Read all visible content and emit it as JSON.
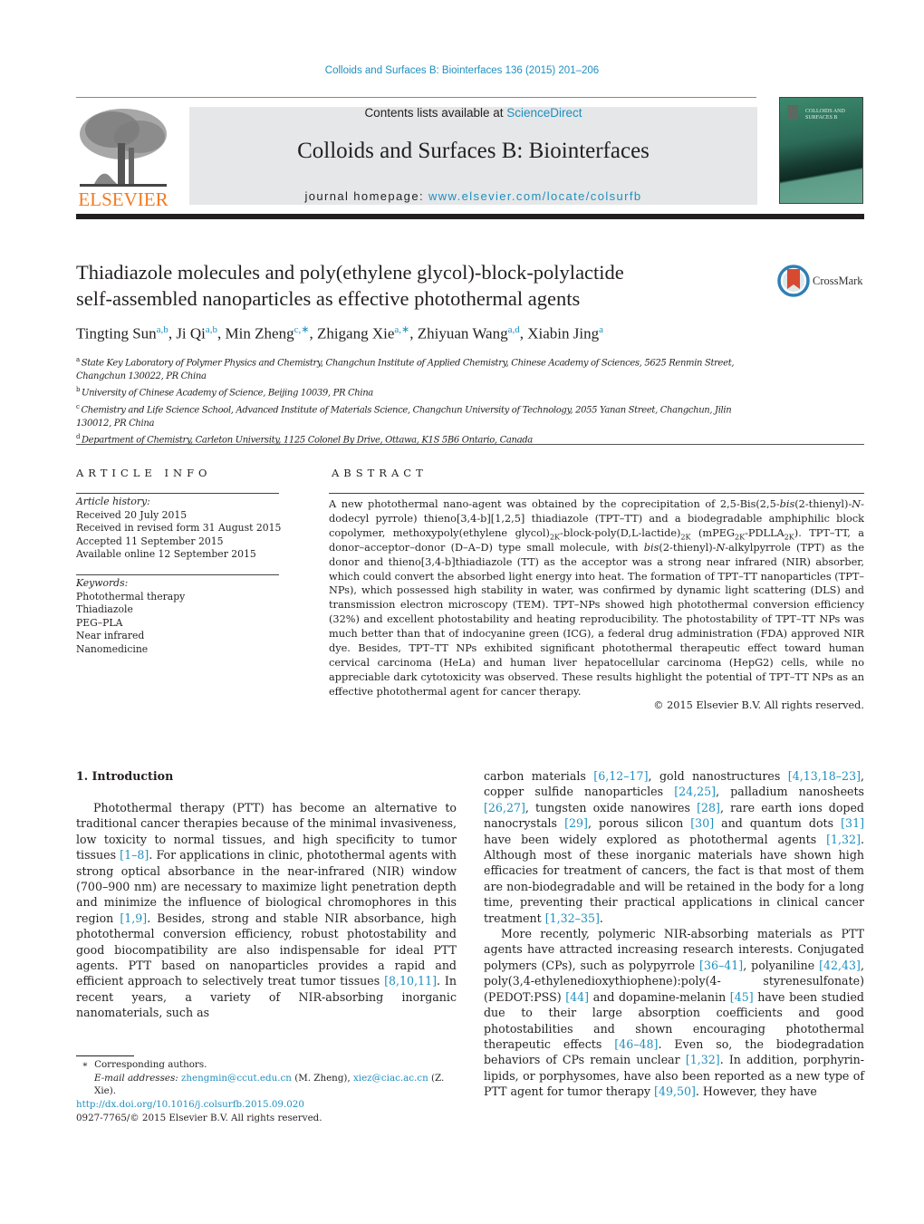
{
  "header": {
    "journal_ref": "Colloids and Surfaces B: Biointerfaces 136 (2015) 201–206",
    "contents_prefix": "Contents lists available at ",
    "contents_link": "ScienceDirect",
    "journal_title": "Colloids and Surfaces B: Biointerfaces",
    "homepage_prefix": "journal homepage: ",
    "homepage_link": "www.elsevier.com/locate/colsurfb",
    "publisher_logo_text": "ELSEVIER",
    "cover_title_line1": "COLLOIDS AND",
    "cover_title_line2": "SURFACES B"
  },
  "article": {
    "title_line1": "Thiadiazole molecules and poly(ethylene glycol)-block-polylactide",
    "title_line2": "self-assembled nanoparticles as effective photothermal agents",
    "crossmark_label": "CrossMark",
    "authors": [
      {
        "name": "Tingting Sun",
        "aff": "a,b",
        "sep": ", "
      },
      {
        "name": "Ji Qi",
        "aff": "a,b",
        "sep": ", "
      },
      {
        "name": "Min Zheng",
        "aff": "c,∗",
        "sep": ", "
      },
      {
        "name": "Zhigang Xie",
        "aff": "a,∗",
        "sep": ", "
      },
      {
        "name": "Zhiyuan Wang",
        "aff": "a,d",
        "sep": ", "
      },
      {
        "name": "Xiabin Jing",
        "aff": "a",
        "sep": ""
      }
    ],
    "affiliations": [
      {
        "key": "a",
        "text": "State Key Laboratory of Polymer Physics and Chemistry, Changchun Institute of Applied Chemistry, Chinese Academy of Sciences, 5625 Renmin Street, Changchun 130022, PR China"
      },
      {
        "key": "b",
        "text": "University of Chinese Academy of Science, Beijing 10039, PR China"
      },
      {
        "key": "c",
        "text": "Chemistry and Life Science School, Advanced Institute of Materials Science, Changchun University of Technology, 2055 Yanan Street, Changchun, Jilin 130012, PR China"
      },
      {
        "key": "d",
        "text": "Department of Chemistry, Carleton University, 1125 Colonel By Drive, Ottawa, K1S 5B6 Ontario, Canada"
      }
    ]
  },
  "article_info": {
    "heading": "ARTICLE INFO",
    "history_label": "Article history:",
    "history": [
      "Received 20 July 2015",
      "Received in revised form 31 August 2015",
      "Accepted 11 September 2015",
      "Available online 12 September 2015"
    ],
    "keywords_label": "Keywords:",
    "keywords": [
      "Photothermal therapy",
      "Thiadiazole",
      "PEG–PLA",
      "Near infrared",
      "Nanomedicine"
    ]
  },
  "abstract": {
    "heading": "ABSTRACT",
    "p1": "A new photothermal nano-agent was obtained by the coprecipitation of 2,5-Bis(2,5-",
    "p1_it1": "bis",
    "p2": "(2-thienyl)-",
    "p2_it": "N",
    "p3": "-dodecyl pyrrole) thieno[3,4-b][1,2,5] thiadiazole (TPT–TT) and a biodegradable amphiphilic block copolymer, methoxypoly(ethylene glycol)",
    "sub1": "2K",
    "p4": "-block-poly(D,L-lactide)",
    "sub2": "2K",
    "p5": " (mPEG",
    "sub3": "2K",
    "p6": "-PDLLA",
    "sub4": "2K",
    "p7": "). TPT–TT, a donor–acceptor–donor (D–A–D) type small molecule, with ",
    "p7_it": "bis",
    "p8": "(2-thienyl)-",
    "p8_it": "N",
    "p9": "-alkylpyrrole (TPT) as the donor and thieno[3,4-b]thiadiazole (TT) as the acceptor was a strong near infrared (NIR) absorber, which could convert the absorbed light energy into heat. The formation of TPT–TT nanoparticles (TPT–NPs), which possessed high stability in water, was confirmed by dynamic light scattering (DLS) and transmission electron microscopy (TEM). TPT–NPs showed high photothermal conversion efficiency (32%) and excellent photostability and heating reproducibility. The photostability of TPT–TT NPs was much better than that of indocyanine green (ICG), a federal drug administration (FDA) approved NIR dye. Besides, TPT–TT NPs exhibited significant photothermal therapeutic effect toward human cervical carcinoma (HeLa) and human liver hepatocellular carcinoma (HepG2) cells, while no appreciable dark cytotoxicity was observed. These results highlight the potential of TPT–TT NPs as an effective photothermal agent for cancer therapy.",
    "copyright": "© 2015 Elsevier B.V. All rights reserved."
  },
  "introduction": {
    "heading": "1.  Introduction",
    "left": [
      {
        "t": "Photothermal therapy (PTT) has become an alternative to traditional cancer therapies because of the minimal invasiveness, low toxicity to normal tissues, and high specificity to tumor tissues "
      },
      {
        "r": "[1–8]"
      },
      {
        "t": ". For applications in clinic, photothermal agents with strong optical absorbance in the near-infrared (NIR) window (700–900 nm) are necessary to maximize light penetration depth and minimize the influence of biological chromophores in this region "
      },
      {
        "r": "[1,9]"
      },
      {
        "t": ". Besides, strong and stable NIR absorbance, high photothermal conversion efficiency, robust photostability and good biocompatibility are also indispensable for ideal PTT agents. PTT based on nanoparticles provides a rapid and efficient approach to selectively treat tumor tissues "
      },
      {
        "r": "[8,10,11]"
      },
      {
        "t": ". In recent years, a variety of NIR-absorbing inorganic nanomaterials, such as"
      }
    ],
    "right_p1": [
      {
        "t": "carbon materials "
      },
      {
        "r": "[6,12–17]"
      },
      {
        "t": ", gold nanostructures "
      },
      {
        "r": "[4,13,18–23]"
      },
      {
        "t": ", copper sulfide nanoparticles "
      },
      {
        "r": "[24,25]"
      },
      {
        "t": ", palladium nanosheets "
      },
      {
        "r": "[26,27]"
      },
      {
        "t": ", tungsten oxide nanowires "
      },
      {
        "r": "[28]"
      },
      {
        "t": ", rare earth ions doped nanocrystals "
      },
      {
        "r": "[29]"
      },
      {
        "t": ", porous silicon "
      },
      {
        "r": "[30]"
      },
      {
        "t": " and quantum dots "
      },
      {
        "r": "[31]"
      },
      {
        "t": " have been widely explored as photothermal agents "
      },
      {
        "r": "[1,32]"
      },
      {
        "t": ". Although most of these inorganic materials have shown high efficacies for treatment of cancers, the fact is that most of them are non-biodegradable and will be retained in the body for a long time, preventing their practical applications in clinical cancer treatment "
      },
      {
        "r": "[1,32–35]"
      },
      {
        "t": "."
      }
    ],
    "right_p2": [
      {
        "t": "More recently, polymeric NIR-absorbing materials as PTT agents have attracted increasing research interests. Conjugated polymers (CPs), such as polypyrrole "
      },
      {
        "r": "[36–41]"
      },
      {
        "t": ", polyaniline "
      },
      {
        "r": "[42,43]"
      },
      {
        "t": ", poly(3,4-ethylenedioxythiophene):poly(4- styrenesulfonate) (PEDOT:PSS) "
      },
      {
        "r": "[44]"
      },
      {
        "t": " and dopamine-melanin "
      },
      {
        "r": "[45]"
      },
      {
        "t": " have been studied due to their large absorption coefficients and good photostabilities and shown encouraging photothermal therapeutic effects "
      },
      {
        "r": "[46–48]"
      },
      {
        "t": ". Even so, the biodegradation behaviors of CPs remain unclear "
      },
      {
        "r": "[1,32]"
      },
      {
        "t": ". In addition, porphyrin-lipids, or porphysomes, have also been reported as a new type of PTT agent for tumor therapy "
      },
      {
        "r": "[49,50]"
      },
      {
        "t": ". However, they have"
      }
    ]
  },
  "footnotes": {
    "star": "∗",
    "corresponding": "Corresponding authors.",
    "email_label": "E-mail addresses:",
    "email1": "zhengmin@ccut.edu.cn",
    "email1_owner": " (M. Zheng), ",
    "email2": "xiez@ciac.ac.cn",
    "email2_owner": " (Z. Xie).",
    "doi": "http://dx.doi.org/10.1016/j.colsurfb.2015.09.020",
    "issn": "0927-7765/© 2015 Elsevier B.V. All rights reserved."
  },
  "colors": {
    "link": "#1f8fbf",
    "elsevier_orange": "#f47a20",
    "banner_gray": "#e6e7e8",
    "crossmark_red": "#d64a32",
    "crossmark_ring": "#2f7fb5"
  }
}
